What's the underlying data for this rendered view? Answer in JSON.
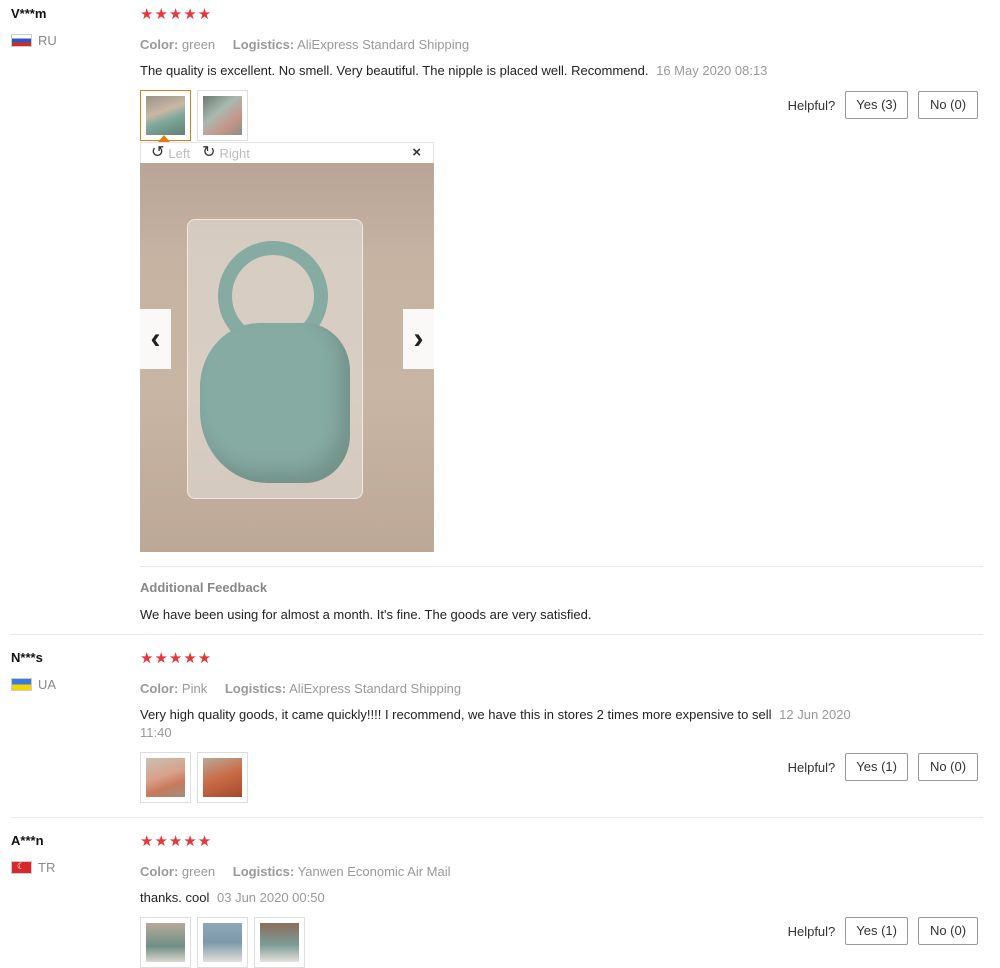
{
  "reviews": [
    {
      "user": "V***m",
      "country": "RU",
      "stars": "★★★★★",
      "color_label": "Color:",
      "color": "green",
      "logistics_label": "Logistics:",
      "logistics": "AliExpress Standard Shipping",
      "text": "The quality is excellent. No smell. Very beautiful. The nipple is placed well. Recommend.",
      "date": "16 May 2020 08:13",
      "helpful_label": "Helpful?",
      "yes": "Yes (3)",
      "no": "No (0)",
      "viewer": {
        "left": "Left",
        "right": "Right",
        "close": "×",
        "prev": "‹",
        "next": "›"
      },
      "additional_title": "Additional Feedback",
      "additional_text": "We have been using for almost a month. It's fine. The goods are very satisfied."
    },
    {
      "user": "N***s",
      "country": "UA",
      "stars": "★★★★★",
      "color_label": "Color:",
      "color": "Pink",
      "logistics_label": "Logistics:",
      "logistics": "AliExpress Standard Shipping",
      "text": "Very high quality goods, it came quickly!!!! I recommend, we have this in stores 2 times more expensive to sell",
      "date": "12 Jun 2020 11:40",
      "helpful_label": "Helpful?",
      "yes": "Yes (1)",
      "no": "No (0)"
    },
    {
      "user": "A***n",
      "country": "TR",
      "stars": "★★★★★",
      "color_label": "Color:",
      "color": "green",
      "logistics_label": "Logistics:",
      "logistics": "Yanwen Economic Air Mail",
      "text": "thanks. cool",
      "date": "03 Jun 2020 00:50",
      "helpful_label": "Helpful?",
      "yes": "Yes (1)",
      "no": "No (0)"
    }
  ],
  "colors": {
    "star": "#e4393c",
    "active_border": "#e27b15",
    "muted": "#999999"
  }
}
